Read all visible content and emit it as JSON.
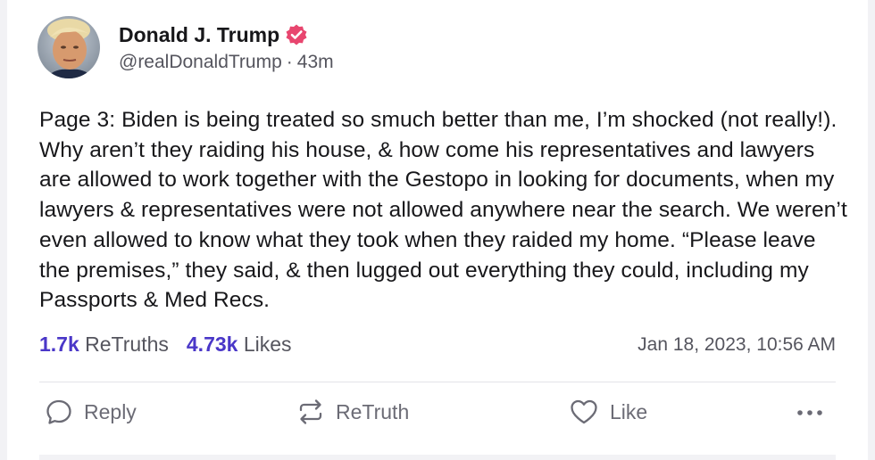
{
  "post": {
    "author": {
      "display_name": "Donald J. Trump",
      "handle": "@realDonaldTrump",
      "verified_icon": "verified-badge-icon"
    },
    "relative_time": "43m",
    "separator": "·",
    "text": "Page 3: Biden is being treated so smuch better than me, I’m shocked (not really!). Why aren’t they raiding his house, & how come his representatives and lawyers are allowed to work together with the Gestopo in looking for documents, when my lawyers & representatives were not allowed anywhere near the search. We weren’t even allowed to know what they took when they raided my home. “Please leave the premises,” they said, & then lugged out everything they could, including my Passports & Med Recs.",
    "stats": {
      "retruths_count": "1.7k",
      "retruths_label": "ReTruths",
      "likes_count": "4.73k",
      "likes_label": "Likes"
    },
    "timestamp": "Jan 18, 2023, 10:56 AM"
  },
  "actions": {
    "reply_label": "Reply",
    "retruth_label": "ReTruth",
    "like_label": "Like"
  },
  "colors": {
    "accent": "#4a37c8",
    "verified": "#e8466f",
    "muted_text": "#55555e"
  }
}
